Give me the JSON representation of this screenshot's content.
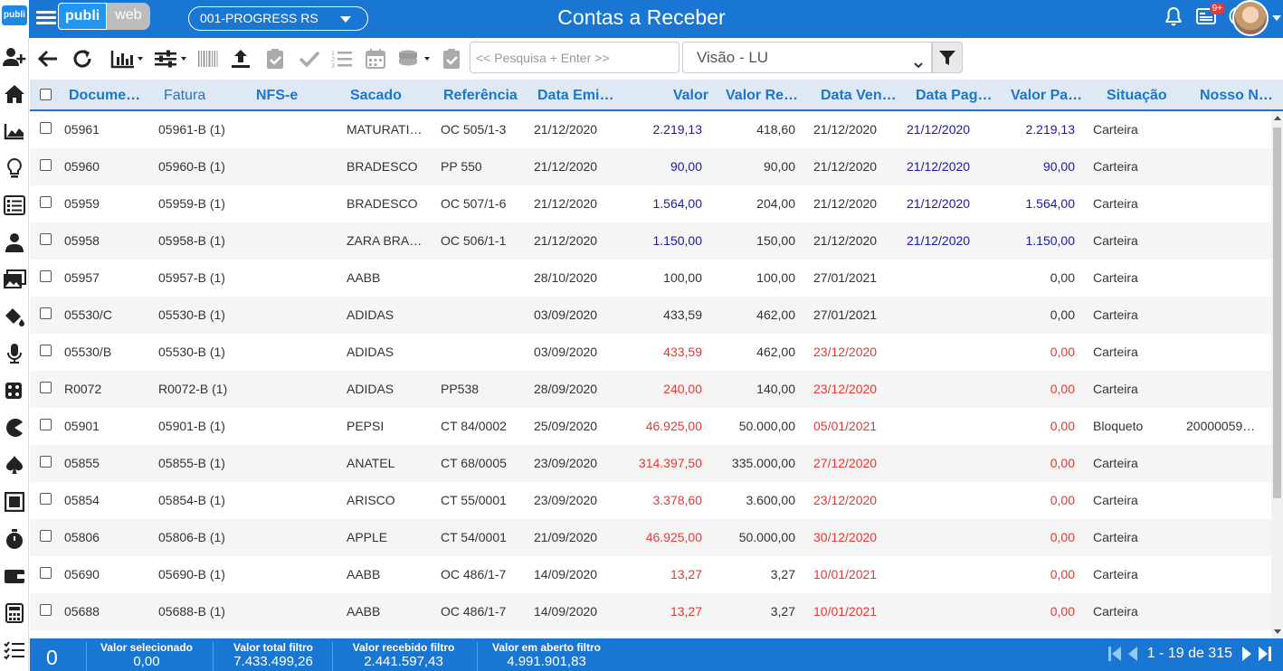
{
  "topbar": {
    "logo_small": "publi",
    "brand_part1": "publi",
    "brand_part2": "web",
    "company": "001-PROGRESS RS",
    "title": "Contas a Receber",
    "notifications_badge": "9+"
  },
  "toolbar": {
    "search_placeholder": "<< Pesquisa + Enter >>",
    "view": "Visão - LU"
  },
  "grid": {
    "columns": [
      "Docume…",
      "Fatura",
      "NFS-e",
      "Sacado",
      "Referência",
      "Data Emi…",
      "Valor",
      "Valor Re…",
      "Data Ven…",
      "Data Pag…",
      "Valor Pa…",
      "Situação",
      "Nosso N…"
    ],
    "rows": [
      {
        "doc": "05961",
        "fatura": "05961-B (1)",
        "nfse": "",
        "sacado": "MATURATI…",
        "ref": "OC 505/1-3",
        "emissao": "21/12/2020",
        "valor": "2.219,13",
        "valor_rec": "418,60",
        "venc": "21/12/2020",
        "pag": "21/12/2020",
        "valor_pago": "2.219,13",
        "situacao": "Carteira",
        "nosso": "",
        "tone": "blue"
      },
      {
        "doc": "05960",
        "fatura": "05960-B (1)",
        "nfse": "",
        "sacado": "BRADESCO",
        "ref": "PP 550",
        "emissao": "21/12/2020",
        "valor": "90,00",
        "valor_rec": "90,00",
        "venc": "21/12/2020",
        "pag": "21/12/2020",
        "valor_pago": "90,00",
        "situacao": "Carteira",
        "nosso": "",
        "tone": "blue"
      },
      {
        "doc": "05959",
        "fatura": "05959-B (1)",
        "nfse": "",
        "sacado": "BRADESCO",
        "ref": "OC 507/1-6",
        "emissao": "21/12/2020",
        "valor": "1.564,00",
        "valor_rec": "204,00",
        "venc": "21/12/2020",
        "pag": "21/12/2020",
        "valor_pago": "1.564,00",
        "situacao": "Carteira",
        "nosso": "",
        "tone": "blue"
      },
      {
        "doc": "05958",
        "fatura": "05958-B (1)",
        "nfse": "",
        "sacado": "ZARA BRA…",
        "ref": "OC 506/1-1",
        "emissao": "21/12/2020",
        "valor": "1.150,00",
        "valor_rec": "150,00",
        "venc": "21/12/2020",
        "pag": "21/12/2020",
        "valor_pago": "1.150,00",
        "situacao": "Carteira",
        "nosso": "",
        "tone": "blue"
      },
      {
        "doc": "05957",
        "fatura": "05957-B (1)",
        "nfse": "",
        "sacado": "AABB",
        "ref": "",
        "emissao": "28/10/2020",
        "valor": "100,00",
        "valor_rec": "100,00",
        "venc": "27/01/2021",
        "pag": "",
        "valor_pago": "0,00",
        "situacao": "Carteira",
        "nosso": "",
        "tone": "normal"
      },
      {
        "doc": "05530/C",
        "fatura": "05530-B (1)",
        "nfse": "",
        "sacado": "ADIDAS",
        "ref": "",
        "emissao": "03/09/2020",
        "valor": "433,59",
        "valor_rec": "462,00",
        "venc": "27/01/2021",
        "pag": "",
        "valor_pago": "0,00",
        "situacao": "Carteira",
        "nosso": "",
        "tone": "normal"
      },
      {
        "doc": "05530/B",
        "fatura": "05530-B (1)",
        "nfse": "",
        "sacado": "ADIDAS",
        "ref": "",
        "emissao": "03/09/2020",
        "valor": "433,59",
        "valor_rec": "462,00",
        "venc": "23/12/2020",
        "pag": "",
        "valor_pago": "0,00",
        "situacao": "Carteira",
        "nosso": "",
        "tone": "red"
      },
      {
        "doc": "R0072",
        "fatura": "R0072-B (1)",
        "nfse": "",
        "sacado": "ADIDAS",
        "ref": "PP538",
        "emissao": "28/09/2020",
        "valor": "240,00",
        "valor_rec": "140,00",
        "venc": "23/12/2020",
        "pag": "",
        "valor_pago": "0,00",
        "situacao": "Carteira",
        "nosso": "",
        "tone": "red"
      },
      {
        "doc": "05901",
        "fatura": "05901-B (1)",
        "nfse": "",
        "sacado": "PEPSI",
        "ref": "CT 84/0002",
        "emissao": "25/09/2020",
        "valor": "46.925,00",
        "valor_rec": "50.000,00",
        "venc": "05/01/2021",
        "pag": "",
        "valor_pago": "0,00",
        "situacao": "Bloqueto",
        "nosso": "20000059…",
        "tone": "red"
      },
      {
        "doc": "05855",
        "fatura": "05855-B (1)",
        "nfse": "",
        "sacado": "ANATEL",
        "ref": "CT 68/0005",
        "emissao": "23/09/2020",
        "valor": "314.397,50",
        "valor_rec": "335.000,00",
        "venc": "27/12/2020",
        "pag": "",
        "valor_pago": "0,00",
        "situacao": "Carteira",
        "nosso": "",
        "tone": "red"
      },
      {
        "doc": "05854",
        "fatura": "05854-B (1)",
        "nfse": "",
        "sacado": "ARISCO",
        "ref": "CT 55/0001",
        "emissao": "23/09/2020",
        "valor": "3.378,60",
        "valor_rec": "3.600,00",
        "venc": "23/12/2020",
        "pag": "",
        "valor_pago": "0,00",
        "situacao": "Carteira",
        "nosso": "",
        "tone": "red"
      },
      {
        "doc": "05806",
        "fatura": "05806-B (1)",
        "nfse": "",
        "sacado": "APPLE",
        "ref": "CT 54/0001",
        "emissao": "21/09/2020",
        "valor": "46.925,00",
        "valor_rec": "50.000,00",
        "venc": "30/12/2020",
        "pag": "",
        "valor_pago": "0,00",
        "situacao": "Carteira",
        "nosso": "",
        "tone": "red"
      },
      {
        "doc": "05690",
        "fatura": "05690-B (1)",
        "nfse": "",
        "sacado": "AABB",
        "ref": "OC 486/1-7",
        "emissao": "14/09/2020",
        "valor": "13,27",
        "valor_rec": "3,27",
        "venc": "10/01/2021",
        "pag": "",
        "valor_pago": "0,00",
        "situacao": "Carteira",
        "nosso": "",
        "tone": "red"
      },
      {
        "doc": "05688",
        "fatura": "05688-B (1)",
        "nfse": "",
        "sacado": "AABB",
        "ref": "OC 486/1-7",
        "emissao": "14/09/2020",
        "valor": "13,27",
        "valor_rec": "3,27",
        "venc": "10/01/2021",
        "pag": "",
        "valor_pago": "0,00",
        "situacao": "Carteira",
        "nosso": "",
        "tone": "red"
      }
    ]
  },
  "footer": {
    "selected_count": "0",
    "valor_selecionado_label": "Valor selecionado",
    "valor_selecionado": "0,00",
    "valor_total_label": "Valor total filtro",
    "valor_total": "7.433.499,26",
    "valor_recebido_label": "Valor recebido filtro",
    "valor_recebido": "2.441.597,43",
    "valor_aberto_label": "Valor em aberto filtro",
    "valor_aberto": "4.991.901,83",
    "pagination": "1 - 19 de 315"
  },
  "colors": {
    "primary": "#1976d2",
    "header_bg": "#dfe9f5",
    "blue_value": "#1a1aa6",
    "red_value": "#e53935"
  },
  "sidebar_icons": [
    "add-user-icon",
    "home-icon",
    "area-chart-icon",
    "lightbulb-icon",
    "list-icon",
    "person-icon",
    "images-icon",
    "paint-bucket-icon",
    "microphone-icon",
    "dice-icon",
    "pacman-icon",
    "spade-icon",
    "square-icon",
    "stopwatch-icon",
    "wallet-icon",
    "calculator-icon",
    "checklist-icon"
  ]
}
